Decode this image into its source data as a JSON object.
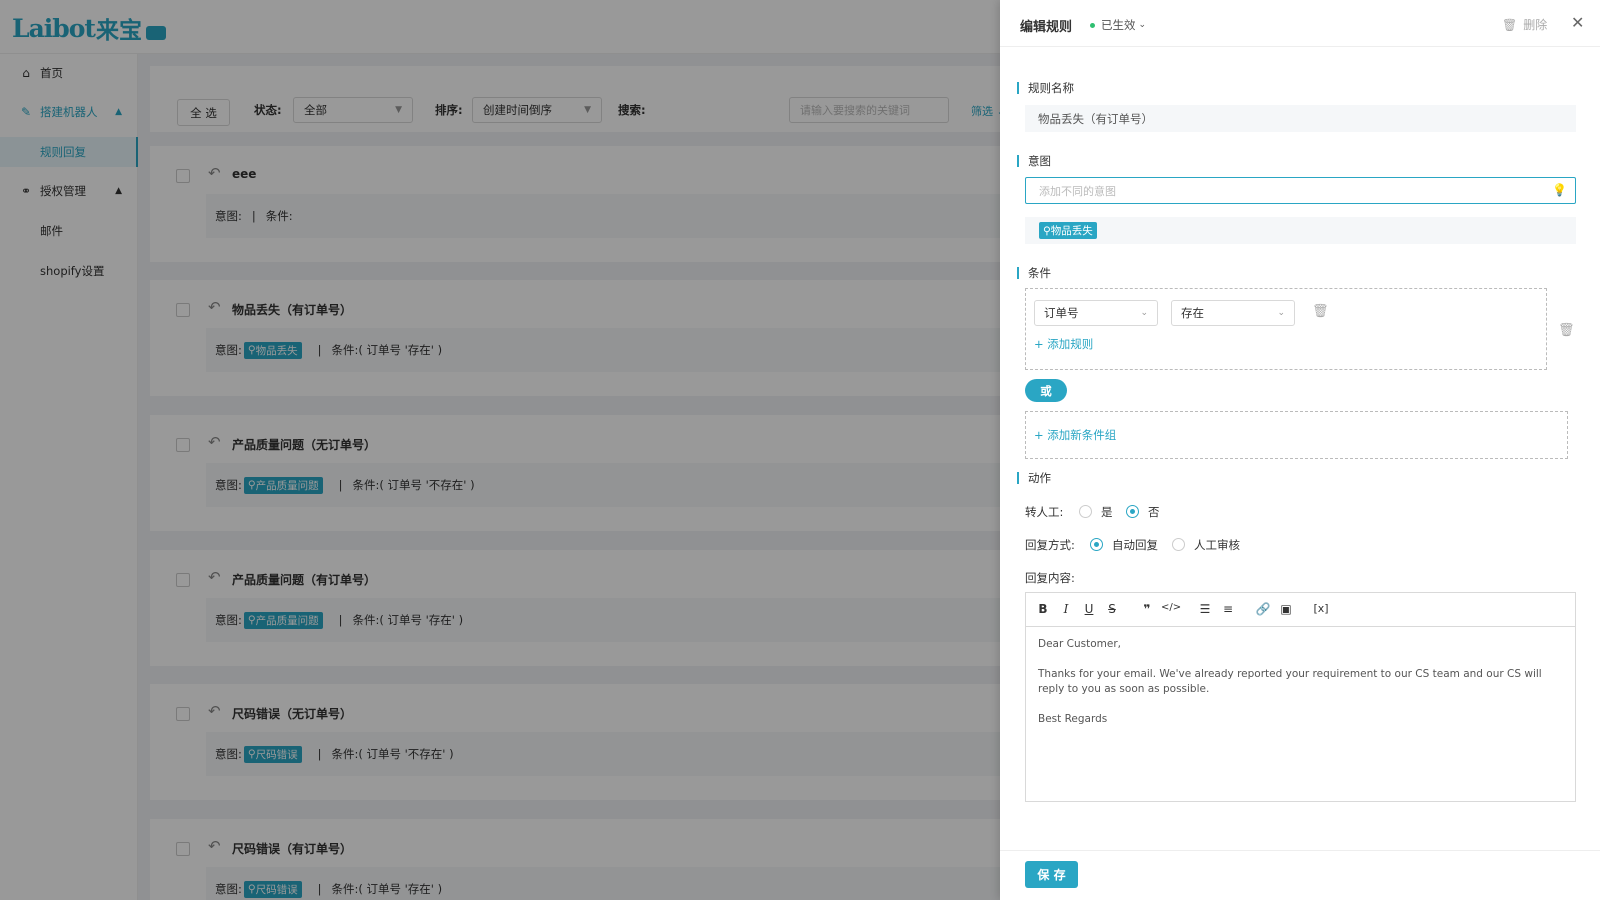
{
  "app": {
    "logo_text": "Laibot",
    "logo_cn": "来宝"
  },
  "sidebar": {
    "items": [
      {
        "label": "首页",
        "icon": "home-icon"
      },
      {
        "label": "搭建机器人",
        "icon": "edit-icon"
      },
      {
        "label": "规则回复"
      },
      {
        "label": "授权管理",
        "icon": "auth-icon"
      },
      {
        "label": "邮件"
      },
      {
        "label": "shopify设置"
      }
    ]
  },
  "filters": {
    "select_all": "全 选",
    "status_label": "状态:",
    "status_value": "全部",
    "sort_label": "排序:",
    "sort_value": "创建时间倒序",
    "search_label": "搜索:",
    "search_placeholder": "请输入要搜索的关键词",
    "screen_link": "筛选"
  },
  "rules": [
    {
      "title": "eee",
      "intent_label": "意图:",
      "tag": "",
      "cond_label": "条件:",
      "cond": ""
    },
    {
      "title": "物品丢失（有订单号）",
      "intent_label": "意图:",
      "tag": "物品丢失",
      "cond_label": "条件:",
      "cond": "( 订单号 '存在' )"
    },
    {
      "title": "产品质量问题（无订单号）",
      "intent_label": "意图:",
      "tag": "产品质量问题",
      "cond_label": "条件:",
      "cond": "( 订单号 '不存在' )"
    },
    {
      "title": "产品质量问题（有订单号）",
      "intent_label": "意图:",
      "tag": "产品质量问题",
      "cond_label": "条件:",
      "cond": "( 订单号 '存在' )"
    },
    {
      "title": "尺码错误（无订单号）",
      "intent_label": "意图:",
      "tag": "尺码错误",
      "cond_label": "条件:",
      "cond": "( 订单号 '不存在' )"
    },
    {
      "title": "尺码错误（有订单号）",
      "intent_label": "意图:",
      "tag": "尺码错误",
      "cond_label": "条件:",
      "cond": "( 订单号 '存在' )"
    }
  ],
  "drawer": {
    "title": "编辑规则",
    "status": "已生效",
    "delete_label": "删除",
    "rule_name_label": "规则名称",
    "rule_name_value": "物品丢失（有订单号）",
    "intent_label": "意图",
    "intent_placeholder": "添加不同的意图",
    "intent_tag": "物品丢失",
    "condition_label": "条件",
    "cond_field": "订单号",
    "cond_op": "存在",
    "add_rule": "添加规则",
    "or_label": "或",
    "add_group": "添加新条件组",
    "action_label": "动作",
    "transfer_label": "转人工:",
    "transfer_yes": "是",
    "transfer_no": "否",
    "reply_mode_label": "回复方式:",
    "reply_auto": "自动回复",
    "reply_manual": "人工审核",
    "reply_content_label": "回复内容:",
    "reply_lines": [
      "Dear Customer,",
      "Thanks for your email. We've already reported your requirement to our CS team and our CS will reply to you as soon as possible.",
      "Best Regards"
    ],
    "save_label": "保 存"
  },
  "colors": {
    "accent": "#2aa6c4",
    "active_dot": "#2fbf71"
  }
}
